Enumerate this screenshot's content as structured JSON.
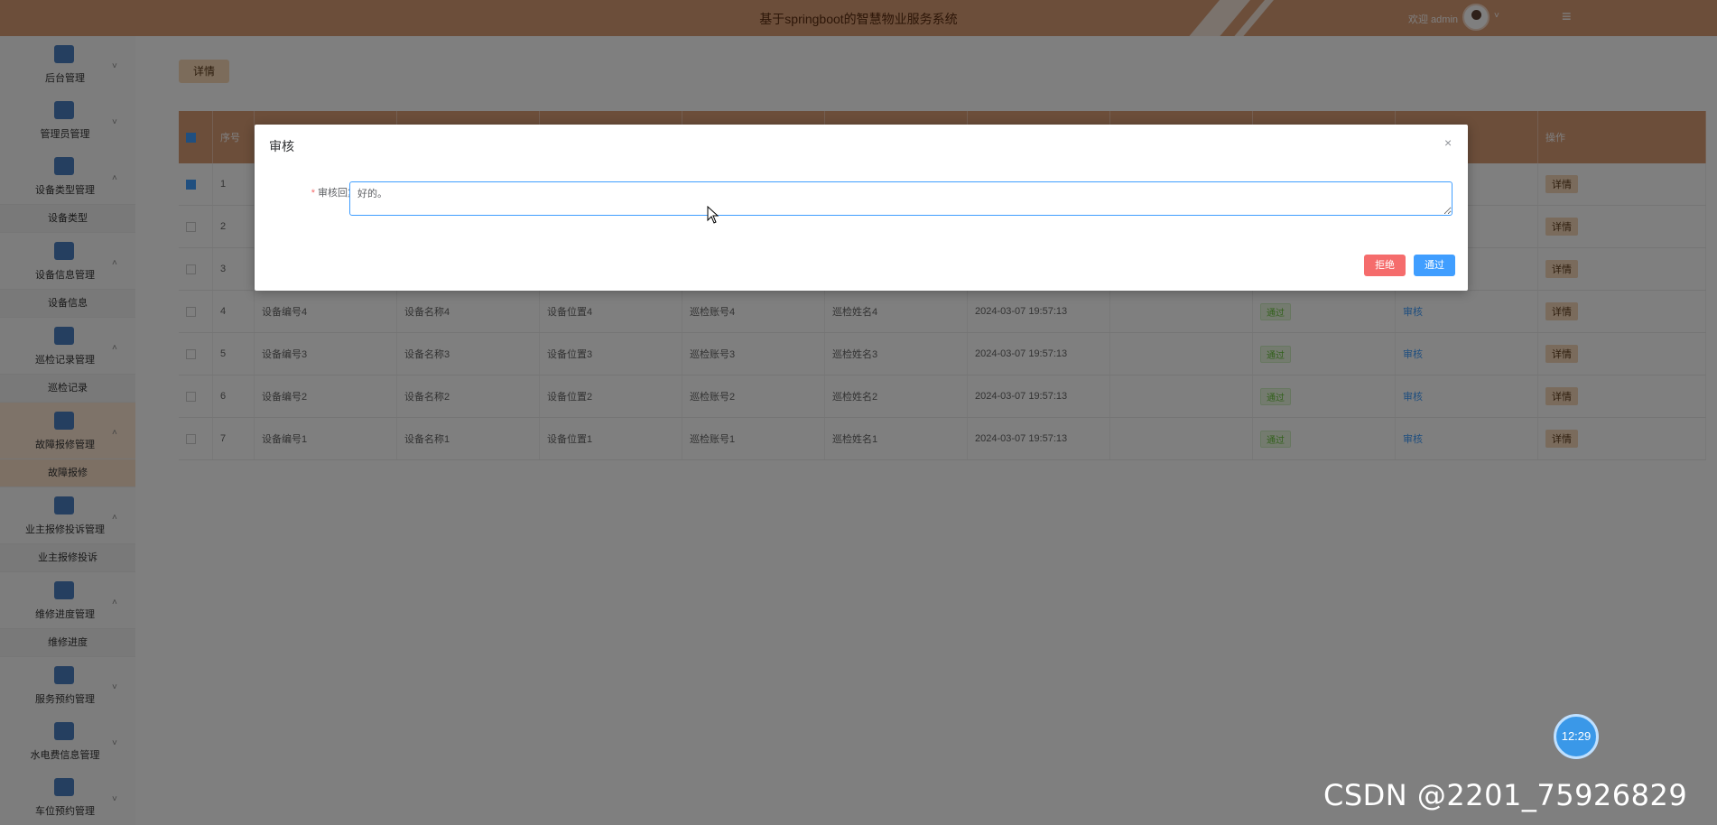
{
  "header": {
    "title": "基于springboot的智慧物业服务系统",
    "welcome": "欢迎 admin",
    "menu_toggle_icon": "hamburger-icon"
  },
  "sidebar": {
    "groups": [
      {
        "label": "后台管理",
        "icon": "archive-icon",
        "arrow": "˅",
        "active": false,
        "sub": null
      },
      {
        "label": "管理员管理",
        "icon": "grid-icon",
        "arrow": "˅",
        "active": false,
        "sub": null
      },
      {
        "label": "设备类型管理",
        "icon": "dots-grid-icon",
        "arrow": "˄",
        "active": false,
        "sub": "设备类型"
      },
      {
        "label": "设备信息管理",
        "icon": "briefcase-icon",
        "arrow": "˄",
        "active": false,
        "sub": "设备信息"
      },
      {
        "label": "巡检记录管理",
        "icon": "compass-icon",
        "arrow": "˄",
        "active": false,
        "sub": "巡检记录"
      },
      {
        "label": "故障报修管理",
        "icon": "wrench-icon",
        "arrow": "˄",
        "active": true,
        "sub": "故障报修"
      },
      {
        "label": "业主报修投诉管理",
        "icon": "window-icon",
        "arrow": "˄",
        "active": false,
        "sub": "业主报修投诉"
      },
      {
        "label": "维修进度管理",
        "icon": "shop-icon",
        "arrow": "˄",
        "active": false,
        "sub": "维修进度"
      },
      {
        "label": "服务预约管理",
        "icon": "bar-chart-icon",
        "arrow": "˅",
        "active": false,
        "sub": null
      },
      {
        "label": "水电费信息管理",
        "icon": "cabinet-icon",
        "arrow": "˅",
        "active": false,
        "sub": null
      },
      {
        "label": "车位预约管理",
        "icon": "gauge-icon",
        "arrow": "˅",
        "active": false,
        "sub": null
      }
    ]
  },
  "toolbar": {
    "detail_label": "详情"
  },
  "table": {
    "headers": [
      "序号",
      "",
      "",
      "",
      "",
      "",
      "",
      "",
      "",
      "",
      "操作"
    ],
    "rows": [
      {
        "checked": true,
        "no": "1",
        "code": "",
        "name": "",
        "loc": "",
        "acct": "",
        "inspector": "",
        "time": "",
        "blank": "",
        "status": "",
        "audit": "",
        "op": "详情"
      },
      {
        "checked": false,
        "no": "2",
        "code": "",
        "name": "",
        "loc": "",
        "acct": "",
        "inspector": "",
        "time": "",
        "blank": "",
        "status": "",
        "audit": "",
        "op": "详情"
      },
      {
        "checked": false,
        "no": "3",
        "code": "",
        "name": "",
        "loc": "",
        "acct": "",
        "inspector": "",
        "time": "",
        "blank": "",
        "status": "",
        "audit": "",
        "op": "详情"
      },
      {
        "checked": false,
        "no": "4",
        "code": "设备编号4",
        "name": "设备名称4",
        "loc": "设备位置4",
        "acct": "巡检账号4",
        "inspector": "巡检姓名4",
        "time": "2024-03-07 19:57:13",
        "blank": "",
        "status": "通过",
        "audit": "审核",
        "op": "详情"
      },
      {
        "checked": false,
        "no": "5",
        "code": "设备编号3",
        "name": "设备名称3",
        "loc": "设备位置3",
        "acct": "巡检账号3",
        "inspector": "巡检姓名3",
        "time": "2024-03-07 19:57:13",
        "blank": "",
        "status": "通过",
        "audit": "审核",
        "op": "详情"
      },
      {
        "checked": false,
        "no": "6",
        "code": "设备编号2",
        "name": "设备名称2",
        "loc": "设备位置2",
        "acct": "巡检账号2",
        "inspector": "巡检姓名2",
        "time": "2024-03-07 19:57:13",
        "blank": "",
        "status": "通过",
        "audit": "审核",
        "op": "详情"
      },
      {
        "checked": false,
        "no": "7",
        "code": "设备编号1",
        "name": "设备名称1",
        "loc": "设备位置1",
        "acct": "巡检账号1",
        "inspector": "巡检姓名1",
        "time": "2024-03-07 19:57:13",
        "blank": "",
        "status": "通过",
        "audit": "审核",
        "op": "详情"
      }
    ]
  },
  "dialog": {
    "title": "审核",
    "close_glyph": "×",
    "required_mark": "*",
    "reply_label": "审核回复",
    "reply_value": "好的。",
    "reject_label": "拒绝",
    "pass_label": "通过"
  },
  "overlay_widgets": {
    "clock": "12:29",
    "watermark": "CSDN @2201_75926829"
  },
  "colors": {
    "header": "#d99c75",
    "primary": "#409eff",
    "danger": "#f56c6c",
    "success": "#67c23a"
  }
}
